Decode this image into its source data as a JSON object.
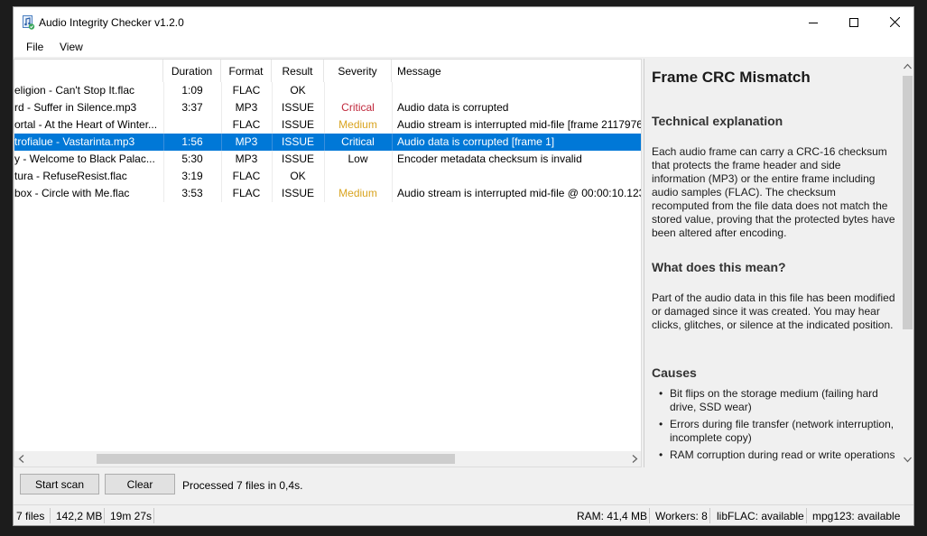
{
  "window": {
    "title": "Audio Integrity Checker v1.2.0"
  },
  "menu": {
    "file": "File",
    "view": "View"
  },
  "table": {
    "columns": {
      "file": "",
      "duration": "Duration",
      "format": "Format",
      "result": "Result",
      "severity": "Severity",
      "message": "Message"
    },
    "rows": [
      {
        "file": "eligion - Can't Stop It.flac",
        "duration": "1:09",
        "format": "FLAC",
        "result": "OK",
        "severity": "",
        "message": ""
      },
      {
        "file": "rd - Suffer in Silence.mp3",
        "duration": "3:37",
        "format": "MP3",
        "result": "ISSUE",
        "severity": "Critical",
        "message": "Audio data is corrupted"
      },
      {
        "file": "ortal - At the Heart of Winter...",
        "duration": "",
        "format": "FLAC",
        "result": "ISSUE",
        "severity": "Medium",
        "message": "Audio stream is interrupted mid-file  [frame 2117976"
      },
      {
        "file": "trofialue - Vastarinta.mp3",
        "duration": "1:56",
        "format": "MP3",
        "result": "ISSUE",
        "severity": "Critical",
        "message": "Audio data is corrupted  [frame 1]"
      },
      {
        "file": "y - Welcome to Black Palac...",
        "duration": "5:30",
        "format": "MP3",
        "result": "ISSUE",
        "severity": "Low",
        "message": "Encoder metadata checksum is invalid"
      },
      {
        "file": "tura - RefuseResist.flac",
        "duration": "3:19",
        "format": "FLAC",
        "result": "OK",
        "severity": "",
        "message": ""
      },
      {
        "file": "box - Circle with Me.flac",
        "duration": "3:53",
        "format": "FLAC",
        "result": "ISSUE",
        "severity": "Medium",
        "message": "Audio stream is interrupted mid-file  @ 00:00:10.123"
      }
    ],
    "selected_row": 3
  },
  "detail": {
    "title": "Frame CRC Mismatch",
    "sections": [
      {
        "heading": "Technical explanation",
        "body": "Each audio frame can carry a CRC-16 checksum that protects the frame header and side information (MP3) or the entire frame including audio samples (FLAC). The checksum recomputed from the file data does not match the stored value, proving that the protected bytes have been altered after encoding."
      },
      {
        "heading": "What does this mean?",
        "body": "Part of the audio data in this file has been modified or damaged since it was created. You may hear clicks, glitches, or silence at the indicated position."
      },
      {
        "heading": "Causes",
        "items": [
          "Bit flips on the storage medium (failing hard drive, SSD wear)",
          "Errors during file transfer (network interruption, incomplete copy)",
          "RAM corruption during read or write operations"
        ]
      }
    ]
  },
  "actions": {
    "start_scan": "Start scan",
    "clear": "Clear",
    "processed": "Processed 7 files in 0,4s."
  },
  "status": {
    "files": "7 files",
    "size": "142,2 MB",
    "duration": "19m 27s",
    "ram": "RAM: 41,4 MB",
    "workers": "Workers: 8",
    "libflac": "libFLAC: available",
    "mpg123": "mpg123: available"
  },
  "colors": {
    "selection": "#0078d7",
    "critical": "#c0283c",
    "medium": "#d9a420"
  }
}
